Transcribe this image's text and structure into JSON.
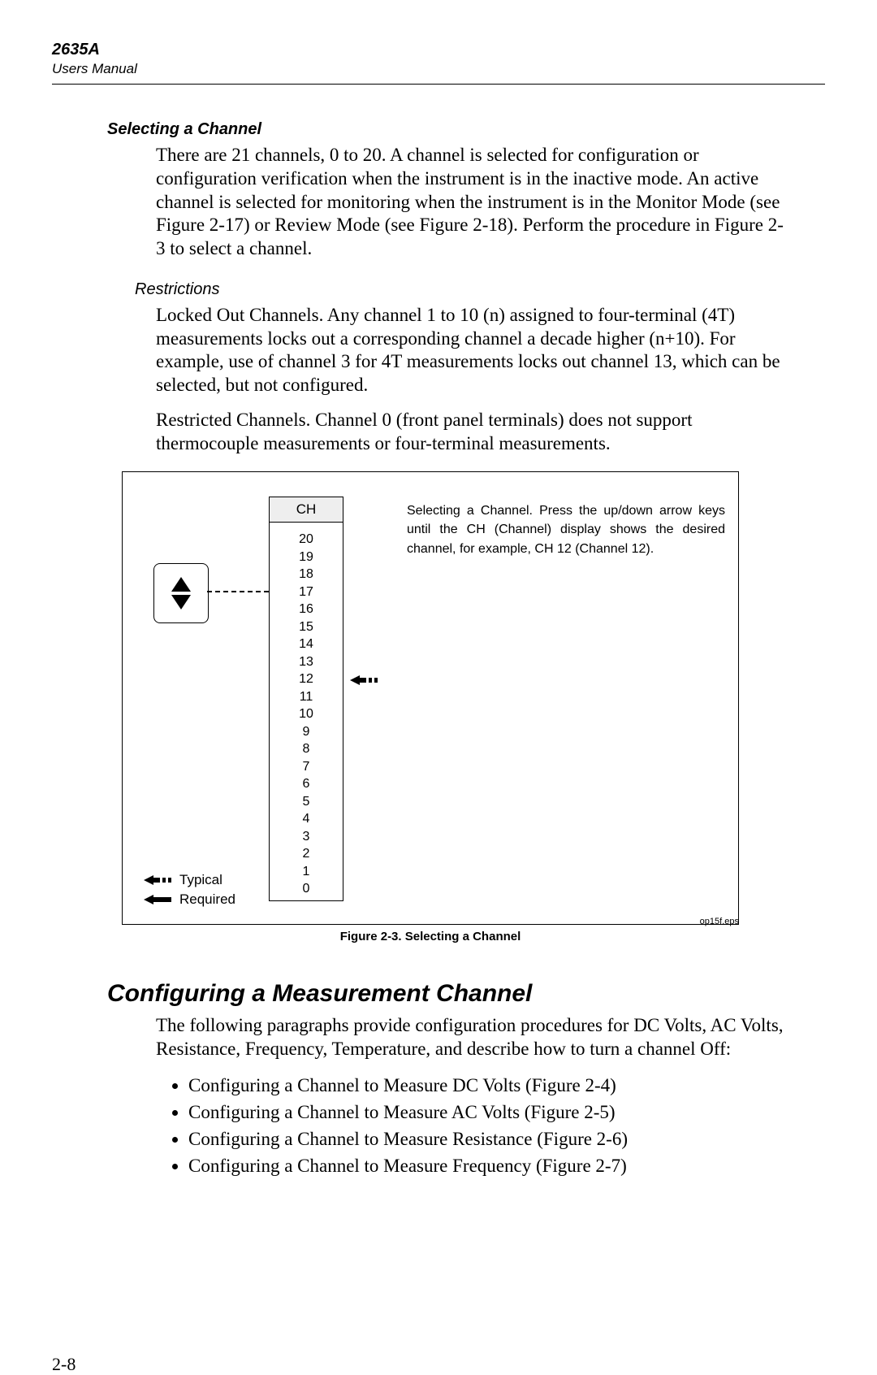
{
  "header": {
    "model": "2635A",
    "manual": "Users Manual"
  },
  "sec1": {
    "title": "Selecting a Channel",
    "p1": "There are 21 channels, 0 to 20. A channel is selected for configuration or configuration verification when the instrument is in the inactive mode. An active channel is selected for monitoring when the instrument is in the Monitor Mode (see Figure 2-17) or Review Mode (see Figure 2-18). Perform the procedure in Figure 2-3 to select a channel."
  },
  "restrictions": {
    "title": "Restrictions",
    "p1": "Locked Out Channels. Any channel 1 to 10 (n) assigned to four-terminal (4T) measurements locks out a corresponding channel a decade higher (n+10). For example, use of channel 3 for 4T measurements locks out channel 13, which can be selected, but not configured.",
    "p2": "Restricted Channels. Channel 0 (front panel terminals) does not support thermocouple measurements or four-terminal measurements."
  },
  "figure": {
    "ch_label": "CH",
    "channels": [
      "20",
      "19",
      "18",
      "17",
      "16",
      "15",
      "14",
      "13",
      "12",
      "11",
      "10",
      "9",
      "8",
      "7",
      "6",
      "5",
      "4",
      "3",
      "2",
      "1",
      "0"
    ],
    "pointer_index": 8,
    "legend_typical": "Typical",
    "legend_required": "Required",
    "caption": "Figure 2-3. Selecting a Channel",
    "eps": "op15f.eps",
    "text": "Selecting a Channel.    Press the up/down arrow keys until the CH (Channel) display shows the desired channel, for example, CH 12 (Channel 12)."
  },
  "sec2": {
    "title": "Configuring a Measurement Channel",
    "intro": "The following paragraphs provide configuration procedures for DC Volts, AC Volts, Resistance, Frequency, Temperature, and describe how to turn a channel Off:",
    "items": [
      "Configuring a Channel to Measure DC Volts (Figure 2-4)",
      "Configuring a Channel to Measure AC Volts (Figure 2-5)",
      "Configuring a Channel to Measure Resistance (Figure 2-6)",
      "Configuring a Channel to Measure Frequency (Figure 2-7)"
    ]
  },
  "page_number": "2-8"
}
